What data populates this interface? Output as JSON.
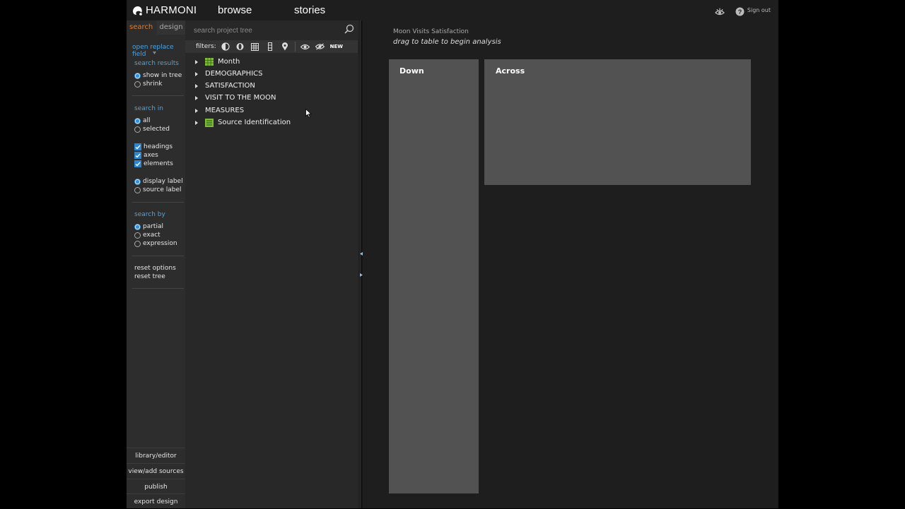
{
  "topbar": {
    "logo_text": "HARMONI",
    "nav": [
      "browse",
      "stories"
    ],
    "signout": "Sign out"
  },
  "options": {
    "tabs": {
      "search": "search",
      "design": "design"
    },
    "open_replace": "open replace field",
    "search_results": {
      "title": "search results",
      "show_in_tree": "show in tree",
      "shrink": "shrink"
    },
    "search_in": {
      "title": "search in",
      "all": "all",
      "selected": "selected"
    },
    "checks": {
      "headings": "headings",
      "axes": "axes",
      "elements": "elements"
    },
    "label_type": {
      "display": "display label",
      "source": "source label"
    },
    "search_by": {
      "title": "search by",
      "partial": "partial",
      "exact": "exact",
      "expression": "expression"
    },
    "reset_options": "reset options",
    "reset_tree": "reset tree",
    "bottom": [
      "library/editor",
      "view/add sources",
      "publish",
      "export design"
    ]
  },
  "tree": {
    "search_placeholder": "search project tree",
    "filters_label": "filters:",
    "new_label": "NEW",
    "items": [
      "Month",
      "DEMOGRAPHICS",
      "SATISFACTION",
      "VISIT TO THE MOON",
      "MEASURES",
      "Source Identification"
    ]
  },
  "main": {
    "title": "Moon Visits Satisfaction",
    "hint": "drag to table to begin analysis",
    "down": "Down",
    "across": "Across"
  },
  "colors": {
    "accent_orange": "#e07a2e",
    "accent_blue": "#4fa3e0",
    "grid_icon_green": "#7dbb3a"
  }
}
